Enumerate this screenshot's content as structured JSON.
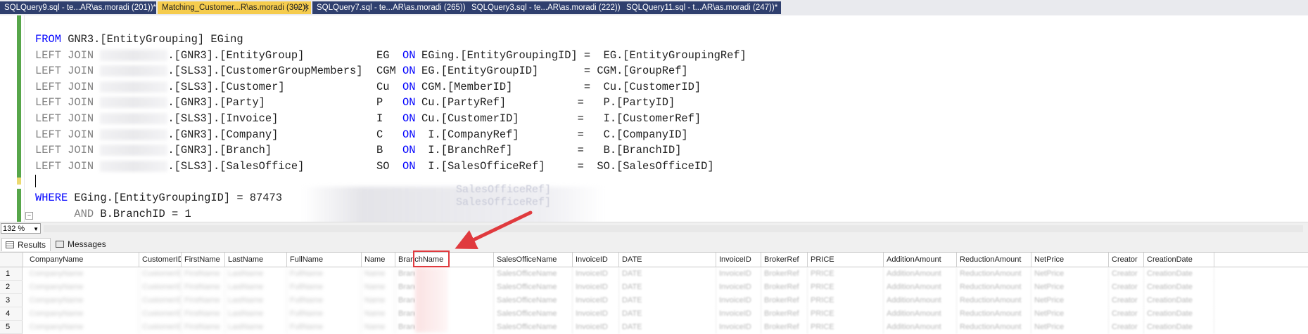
{
  "tabs": [
    {
      "label": "SQLQuery9.sql - te...AR\\as.moradi (201))*",
      "active": false
    },
    {
      "label": "Matching_Customer...R\\as.moradi (302))",
      "active": true
    },
    {
      "label": "SQLQuery7.sql - te...AR\\as.moradi (265))",
      "active": false
    },
    {
      "label": "SQLQuery3.sql - te...AR\\as.moradi (222))",
      "active": false
    },
    {
      "label": "SQLQuery11.sql - t...AR\\as.moradi (247))*",
      "active": false
    }
  ],
  "editor": {
    "from_kw": "FROM",
    "from_rest": " GNR3.[EntityGrouping] EGing",
    "joins": [
      {
        "kw": "LEFT JOIN",
        "table": ".[GNR3].[EntityGroup]",
        "alias": "EG",
        "on": "ON",
        "cond": "EGing.[EntityGroupingID] =  EG.[EntityGroupingRef]"
      },
      {
        "kw": "LEFT JOIN",
        "table": ".[SLS3].[CustomerGroupMembers]",
        "alias": "CGM",
        "on": "ON",
        "cond": "EG.[EntityGroupID]       = CGM.[GroupRef]"
      },
      {
        "kw": "LEFT JOIN",
        "table": ".[SLS3].[Customer]",
        "alias": "Cu",
        "on": "ON",
        "cond": "CGM.[MemberID]           =  Cu.[CustomerID]"
      },
      {
        "kw": "LEFT JOIN",
        "table": ".[GNR3].[Party]",
        "alias": "P",
        "on": "ON",
        "cond": "Cu.[PartyRef]           =   P.[PartyID]"
      },
      {
        "kw": "LEFT JOIN",
        "table": ".[SLS3].[Invoice]",
        "alias": "I",
        "on": "ON",
        "cond": "Cu.[CustomerID]         =   I.[CustomerRef]"
      },
      {
        "kw": "LEFT JOIN",
        "table": ".[GNR3].[Company]",
        "alias": "C",
        "on": "ON",
        "cond": " I.[CompanyRef]         =   C.[CompanyID]"
      },
      {
        "kw": "LEFT JOIN",
        "table": ".[GNR3].[Branch]",
        "alias": "B",
        "on": "ON",
        "cond": " I.[BranchRef]          =   B.[BranchID]"
      },
      {
        "kw": "LEFT JOIN",
        "table": ".[SLS3].[SalesOffice]",
        "alias": "SO",
        "on": "ON",
        "cond": " I.[SalesOfficeRef]     =  SO.[SalesOfficeID]"
      }
    ],
    "where_kw": "WHERE",
    "where_rest": " EGing.[EntityGroupingID] = 87473",
    "and_kw": "AND",
    "and_rest": " B.BranchID = 1",
    "ghost_1": "SalesOfficeRef]",
    "ghost_2": "SalesOfficeRef]"
  },
  "zoom": {
    "value": "132 %"
  },
  "result_tabs": {
    "results": "Results",
    "messages": "Messages"
  },
  "grid": {
    "columns": [
      "CompanyName",
      "CustomerID",
      "FirstName",
      "LastName",
      "FullName",
      "Name",
      "BranchName",
      "SalesOfficeName",
      "InvoiceID",
      "DATE",
      "InvoiceID",
      "BrokerRef",
      "PRICE",
      "AdditionAmount",
      "ReductionAmount",
      "NetPrice",
      "Creator",
      "CreationDate"
    ],
    "rows": [
      {
        "num": "1",
        "cells": [
          "CompanyName",
          "CustomerID",
          "FirstName",
          "LastName",
          "FullName",
          "Name",
          "BranchName",
          "SalesOfficeName",
          "InvoiceID",
          "DATE",
          "InvoiceID",
          "BrokerRef",
          "PRICE",
          "AdditionAmount",
          "ReductionAmount",
          "NetPrice",
          "Creator",
          "CreationDate"
        ]
      },
      {
        "num": "2",
        "cells": [
          "CompanyName",
          "CustomerID",
          "FirstName",
          "LastName",
          "FullName",
          "Name",
          "BranchName",
          "SalesOfficeName",
          "InvoiceID",
          "DATE",
          "InvoiceID",
          "BrokerRef",
          "PRICE",
          "AdditionAmount",
          "ReductionAmount",
          "NetPrice",
          "Creator",
          "CreationDate"
        ]
      },
      {
        "num": "3",
        "cells": [
          "CompanyName",
          "CustomerID",
          "FirstName",
          "LastName",
          "FullName",
          "Name",
          "BranchName",
          "SalesOfficeName",
          "InvoiceID",
          "DATE",
          "InvoiceID",
          "BrokerRef",
          "PRICE",
          "AdditionAmount",
          "ReductionAmount",
          "NetPrice",
          "Creator",
          "CreationDate"
        ]
      },
      {
        "num": "4",
        "cells": [
          "CompanyName",
          "CustomerID",
          "FirstName",
          "LastName",
          "FullName",
          "Name",
          "BranchName",
          "SalesOfficeName",
          "InvoiceID",
          "DATE",
          "InvoiceID",
          "BrokerRef",
          "PRICE",
          "AdditionAmount",
          "ReductionAmount",
          "NetPrice",
          "Creator",
          "CreationDate"
        ]
      },
      {
        "num": "5",
        "cells": [
          "CompanyName",
          "CustomerID",
          "FirstName",
          "LastName",
          "FullName",
          "Name",
          "BranchName",
          "SalesOfficeName",
          "InvoiceID",
          "DATE",
          "InvoiceID",
          "BrokerRef",
          "PRICE",
          "AdditionAmount",
          "ReductionAmount",
          "NetPrice",
          "Creator",
          "CreationDate"
        ]
      }
    ]
  },
  "colors": {
    "active_tab": "#f5cc4e",
    "inactive_tab": "#2f3f6e",
    "keyword": "#0000ff",
    "annotation": "#e03a3e",
    "changed_bar": "#57a64a"
  }
}
